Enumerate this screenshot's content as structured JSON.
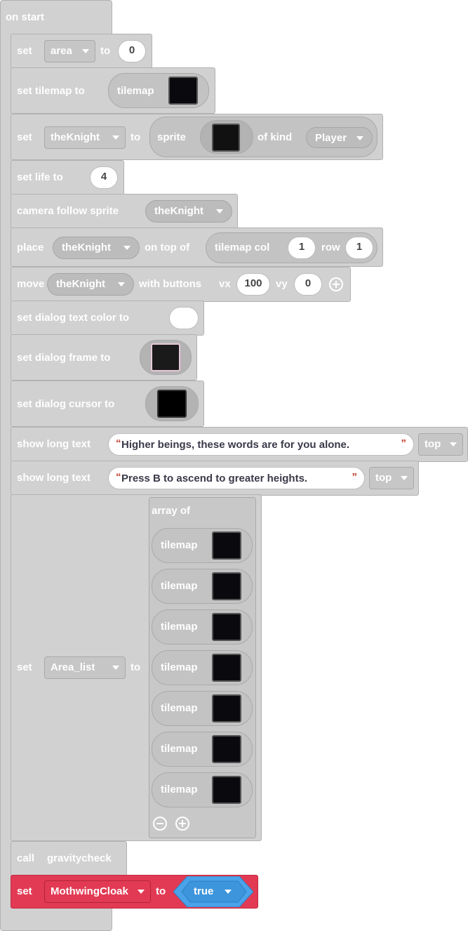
{
  "on_start": {
    "label": "on start"
  },
  "set_area": {
    "set": "set",
    "variable": "area",
    "to": "to",
    "value": "0"
  },
  "set_tilemap": {
    "label": "set tilemap to",
    "arg": "tilemap"
  },
  "set_knight": {
    "set": "set",
    "variable": "theKnight",
    "to": "to",
    "sprite": "sprite",
    "of_kind": "of kind",
    "kind": "Player"
  },
  "set_life": {
    "label": "set life to",
    "value": "4"
  },
  "camera_follow": {
    "label": "camera follow sprite",
    "sprite": "theKnight"
  },
  "place": {
    "label": "place",
    "sprite": "theKnight",
    "on_top_of": "on top of",
    "tilemap_col": "tilemap col",
    "col": "1",
    "row_label": "row",
    "row": "1"
  },
  "move": {
    "label": "move",
    "sprite": "theKnight",
    "with_buttons": "with buttons",
    "vx_label": "vx",
    "vx": "100",
    "vy_label": "vy",
    "vy": "0"
  },
  "dialog_text_color": {
    "label": "set dialog text color to"
  },
  "dialog_frame": {
    "label": "set dialog frame to"
  },
  "dialog_cursor": {
    "label": "set dialog cursor to"
  },
  "show_long_text_1": {
    "label": "show long text",
    "text": "Higher beings, these words are for you alone.",
    "position": "top"
  },
  "show_long_text_2": {
    "label": "show long text",
    "text": "Press B to ascend to greater heights.",
    "position": "top"
  },
  "set_area_list": {
    "set": "set",
    "variable": "Area_list",
    "to": "to",
    "array_of": "array of",
    "items": [
      "tilemap",
      "tilemap",
      "tilemap",
      "tilemap",
      "tilemap",
      "tilemap",
      "tilemap"
    ]
  },
  "call": {
    "label": "call",
    "function": "gravitycheck"
  },
  "set_cloak": {
    "set": "set",
    "variable": "MothwingCloak",
    "to": "to",
    "value": "true"
  },
  "colors": {
    "block_gray": "#d1d1d1",
    "variables_red": "#e23a54",
    "logic_blue": "#4aa3e8"
  }
}
